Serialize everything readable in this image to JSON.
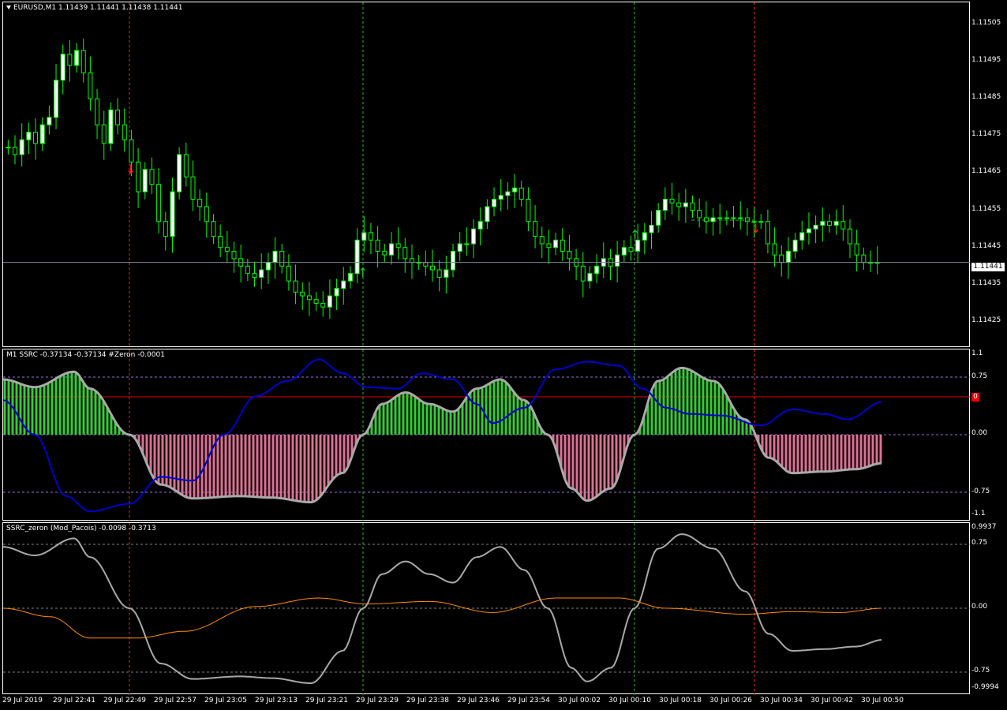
{
  "main": {
    "symbol_label": "EURUSD,M1  1.11439 1.11441 1.11438 1.11441",
    "price_ticks": [
      "1.11505",
      "1.11495",
      "1.11485",
      "1.11475",
      "1.11465",
      "1.11455",
      "1.11445",
      "1.11435",
      "1.11425"
    ],
    "current_price": "1.11441"
  },
  "ind1": {
    "label": "M1 SSRC -0.37134 -0.37134  #Zeron -0.0001",
    "ticks": [
      "1.1",
      "0.75",
      "0.00",
      "-0.75",
      "-1.1"
    ],
    "zero_marker": "0"
  },
  "ind2": {
    "label": "SSRC_zeron (Mod_Pacois) -0.0098 -0.3713",
    "ticks": [
      "0.9937",
      "0.75",
      "0.00",
      "-0.75",
      "-0.9994"
    ]
  },
  "time_axis": [
    "29 Jul 2019",
    "29 Jul 22:41",
    "29 Jul 22:49",
    "29 Jul 22:57",
    "29 Jul 23:05",
    "29 Jul 23:13",
    "29 Jul 23:21",
    "29 Jul 23:29",
    "29 Jul 23:38",
    "29 Jul 23:46",
    "29 Jul 23:54",
    "30 Jul 00:02",
    "30 Jul 00:10",
    "30 Jul 00:18",
    "30 Jul 00:26",
    "30 Jul 00:34",
    "30 Jul 00:42",
    "30 Jul 00:50"
  ],
  "colors": {
    "bull": "#ffffff",
    "bear": "#000000",
    "wick": "#00ff00",
    "ssrc_pos": "#32cd32",
    "ssrc_neg": "#db7093",
    "ssrc_line": "#a9a9a9",
    "zeron": "#0000cd",
    "orange": "#ff8c00",
    "red_level": "#e00000"
  }
}
